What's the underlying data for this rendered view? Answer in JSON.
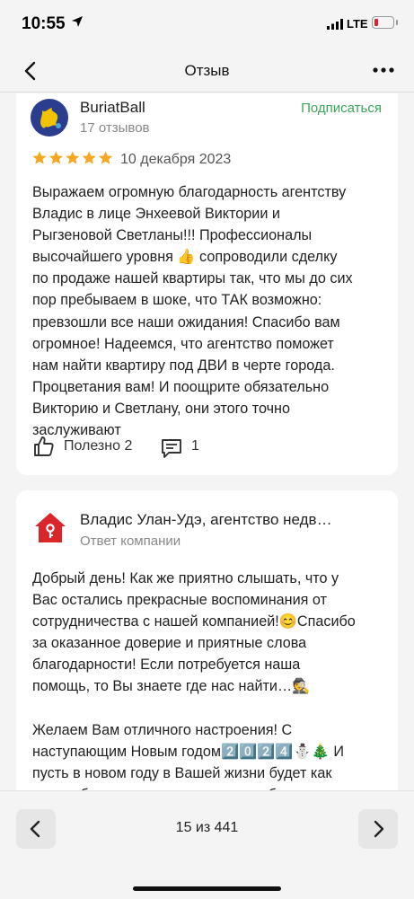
{
  "status": {
    "time": "10:55",
    "network": "LTE"
  },
  "nav": {
    "title": "Отзыв"
  },
  "review": {
    "author": "BuriatBall",
    "reviews_count": "17 отзывов",
    "subscribe_label": "Подписаться",
    "rating": 5,
    "date": "10 декабря 2023",
    "text": "Выражаем огромную благодарность агентству\nВладис в лице Энхеевой Виктории и\nРыгзеновой Светланы!!! Профессионалы\nвысочайшего уровня 👍 сопроводили сделку\nпо продаже нашей квартиры так, что мы до сих\nпор пребываем в шоке, что ТАК возможно:\nпревзошли все наши ожидания! Спасибо вам\nогромное! Надеемся, что агентство поможет\nнам найти квартиру под ДВИ в черте города.\nПроцветания вам! И поощрите обязательно\nВикторию и Светлану, они этого точно\nзаслуживают",
    "useful_label": "Полезно 2",
    "comments_count": "1"
  },
  "reply": {
    "company": "Владис Улан-Удэ, агентство недв…",
    "role": "Ответ компании",
    "text": "Добрый день! Как же приятно слышать, что у\nВас остались прекрасные воспоминания от\nсотрудничества с нашей компанией!😊Спасибо\nза оказанное доверие и приятные слова\nблагодарности! Если потребуется наша\nпомощь, то Вы знаете где нас найти…🕵️\n\nЖелаем Вам отличного настроения! С\nнаступающим Новым годом2️⃣0️⃣2️⃣4️⃣⛄🎄 И\nпусть в новом году в Вашей жизни будет как\nможно больше радостных и волшебных"
  },
  "pagination": {
    "label": "15 из 441"
  },
  "colors": {
    "accent_green": "#3aa65b",
    "star": "#f5a623",
    "house": "#d9262b",
    "avatar_bg": "#2b3d8f"
  },
  "icons": [
    "back-chevron-icon",
    "more-dots-icon",
    "star-icon",
    "thumbs-up-icon",
    "comment-icon",
    "house-logo-icon",
    "chevron-left-icon",
    "chevron-right-icon"
  ]
}
